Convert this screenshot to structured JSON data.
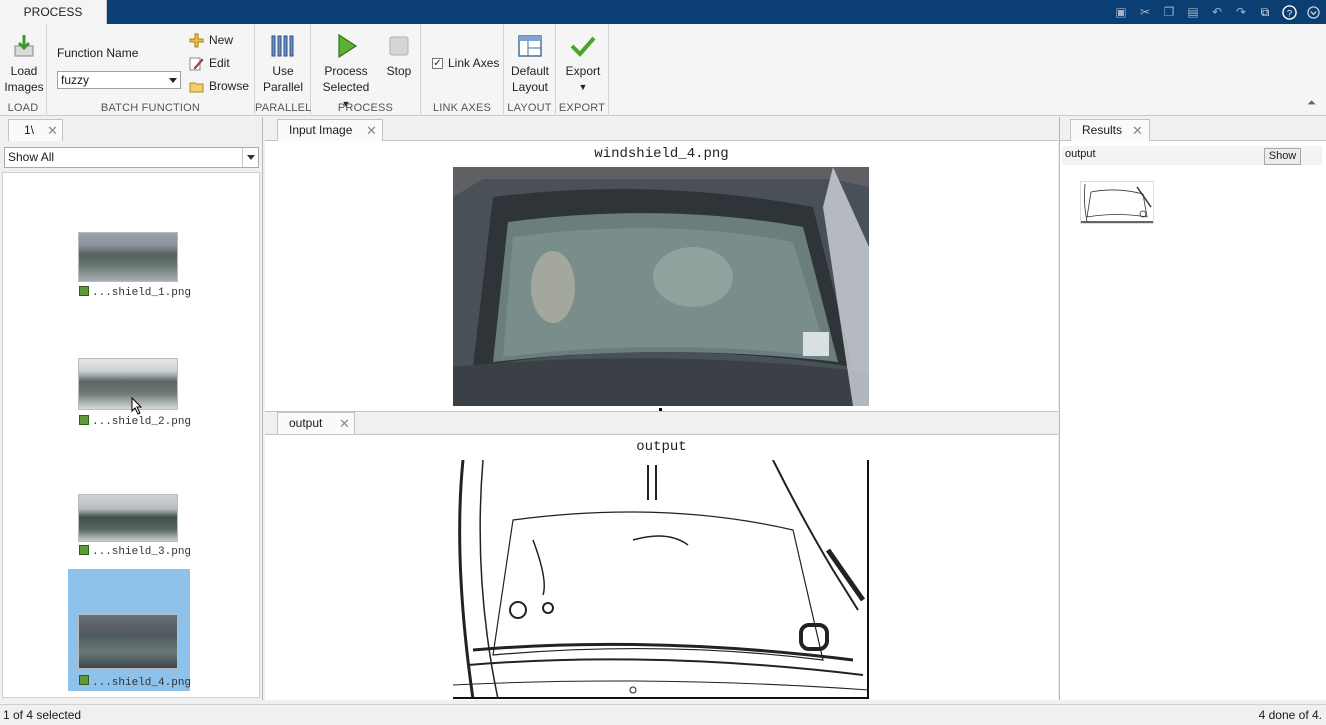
{
  "app": {
    "tab_label": "PROCESS"
  },
  "ribbon": {
    "load": {
      "btn_line1": "Load",
      "btn_line2": "Images",
      "group": "LOAD"
    },
    "batch": {
      "function_name_label": "Function Name",
      "function_value": "fuzzy",
      "new_label": "New",
      "edit_label": "Edit",
      "browse_label": "Browse",
      "group": "BATCH FUNCTION"
    },
    "parallel": {
      "btn_line1": "Use",
      "btn_line2": "Parallel",
      "group": "PARALLEL"
    },
    "process": {
      "process_line1": "Process",
      "process_line2": "Selected",
      "stop_label": "Stop",
      "group": "PROCESS"
    },
    "link": {
      "checkbox_label": "Link Axes",
      "checked": true,
      "group": "LINK AXES"
    },
    "layout": {
      "btn_line1": "Default",
      "btn_line2": "Layout",
      "group": "LAYOUT"
    },
    "export": {
      "btn_label": "Export",
      "group": "EXPORT"
    }
  },
  "left_panel": {
    "tab_label": "1\\",
    "filter_value": "Show All",
    "items": [
      {
        "label": "...shield_1.png"
      },
      {
        "label": "...shield_2.png"
      },
      {
        "label": "...shield_3.png"
      },
      {
        "label": "...shield_4.png",
        "selected": true
      }
    ]
  },
  "center": {
    "input_tab_label": "Input Image",
    "input_title": "windshield_4.png",
    "output_tab_label": "output",
    "output_title": "output"
  },
  "right_panel": {
    "tab_label": "Results",
    "field_label": "output",
    "show_button": "Show"
  },
  "status": {
    "left": "1 of 4 selected",
    "right": "4 done of 4."
  },
  "colors": {
    "titlebar": "#0b3f73",
    "selection": "#8ec2ea",
    "play_green": "#5cb034"
  }
}
